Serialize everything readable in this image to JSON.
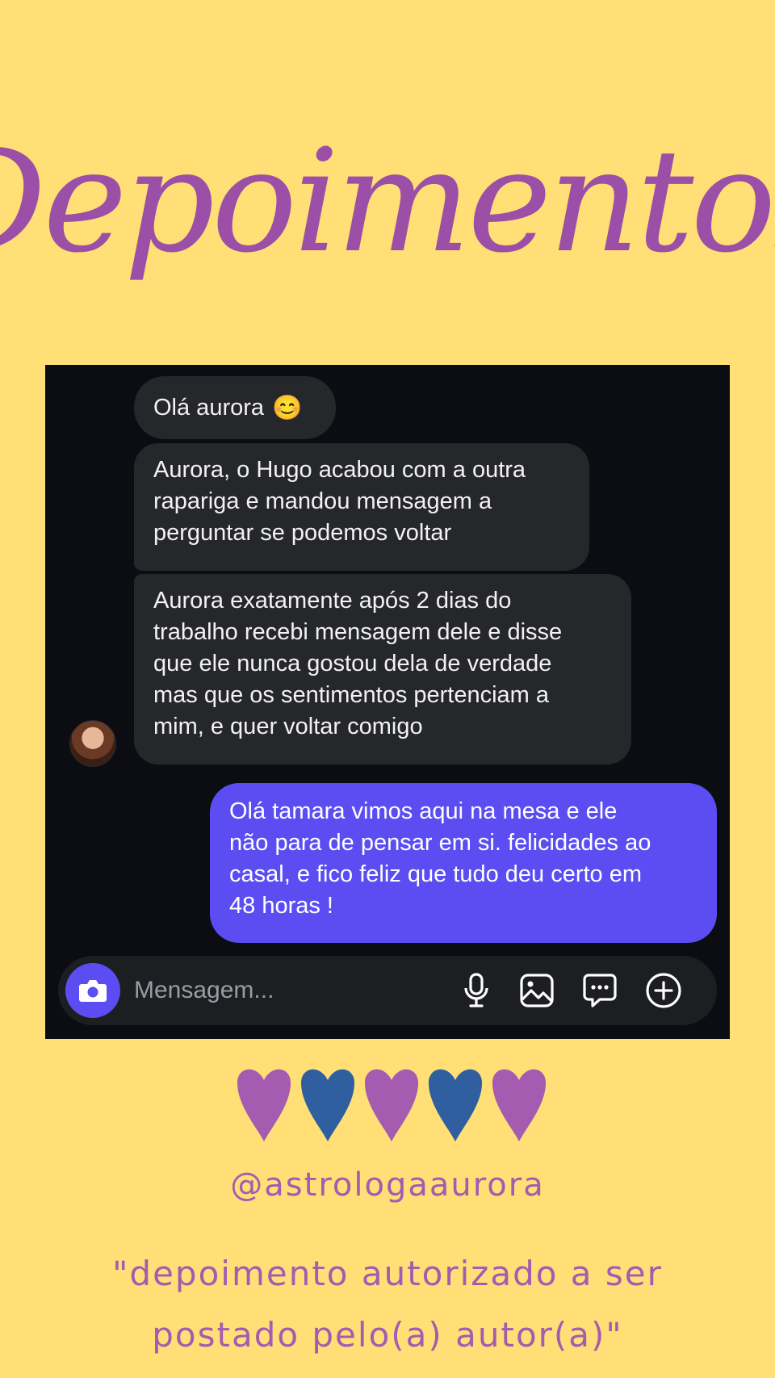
{
  "header": {
    "title": "Depoimentos",
    "title_color": "#9c4fa6"
  },
  "chat": {
    "messages": [
      {
        "sender": "other",
        "text": "Olá aurora",
        "emoji": "😊"
      },
      {
        "sender": "other",
        "text": "Aurora, o Hugo acabou com a outra\nrapariga e mandou mensagem a\nperguntar se podemos voltar"
      },
      {
        "sender": "other",
        "text": "Aurora exatamente após 2 dias do\ntrabalho recebi mensagem dele e disse\nque ele nunca gostou dela de verdade\nmas que os sentimentos pertenciam a\nmim, e quer voltar comigo"
      },
      {
        "sender": "me",
        "text": "Olá tamara vimos aqui na mesa e ele\nnão para de pensar em si. felicidades ao\ncasal, e fico feliz que tudo deu certo em\n48 horas !"
      }
    ],
    "composer": {
      "placeholder": "Mensagem...",
      "icons": [
        "camera-icon",
        "microphone-icon",
        "image-icon",
        "sticker-icon",
        "plus-icon"
      ]
    },
    "colors": {
      "background": "#0b0d12",
      "incoming_bubble": "#26272b",
      "outgoing_bubble": "#5b4df2"
    }
  },
  "decoration": {
    "hearts": [
      "purple",
      "blue",
      "purple",
      "blue",
      "purple"
    ],
    "heart_colors": {
      "purple": "#a45bb0",
      "blue": "#2f5f9f"
    }
  },
  "footer": {
    "handle": "@astrologaaurora",
    "disclaimer_line1": "\"depoimento autorizado a ser",
    "disclaimer_line2": "postado pelo(a) autor(a)\""
  },
  "page": {
    "background": "#ffdf76"
  }
}
